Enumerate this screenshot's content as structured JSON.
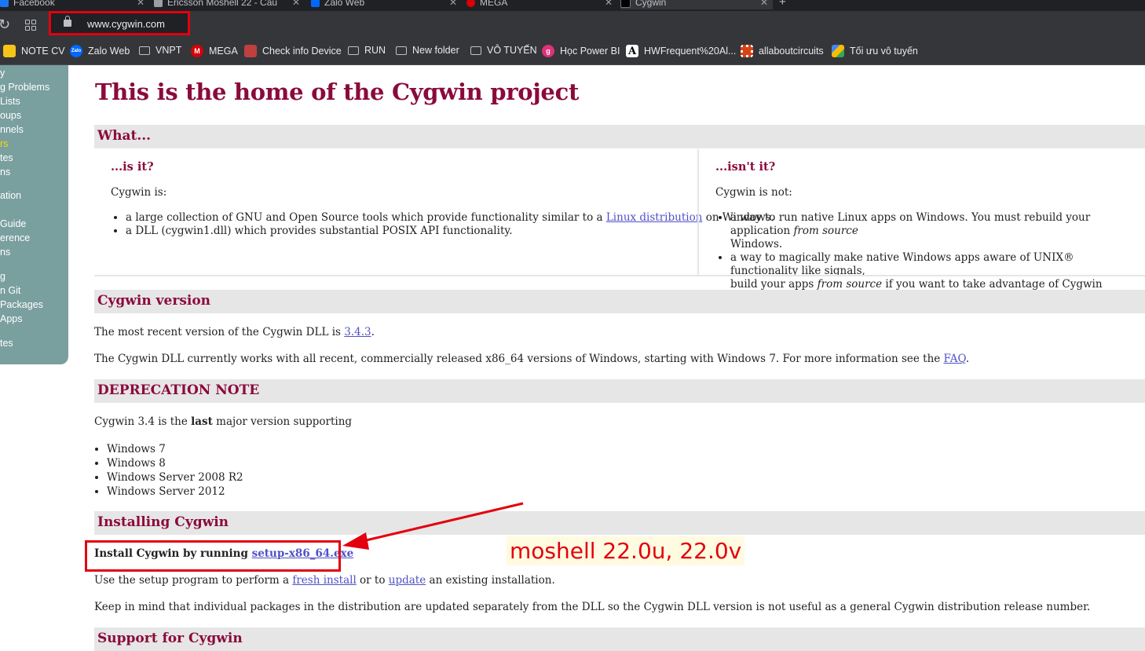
{
  "browser": {
    "tabs": [
      {
        "label": "Facebook",
        "color": "#1877f2"
      },
      {
        "label": "Ericsson Moshell 22 - Câu",
        "color": "#9aa0a6"
      },
      {
        "label": "Zalo Web",
        "color": "#0068ff"
      },
      {
        "label": "MEGA",
        "color": "#d90007"
      },
      {
        "label": "Cygwin",
        "color": "#202124",
        "active": true
      }
    ],
    "url": "www.cygwin.com",
    "bookmarks": [
      {
        "label": "NOTE CV",
        "icon": "note-icon",
        "color": "#f5c518"
      },
      {
        "label": "Zalo Web",
        "icon": "zalo-icon",
        "color": "#0068ff"
      },
      {
        "label": "VNPT",
        "icon": "folder-icon"
      },
      {
        "label": "MEGA",
        "icon": "mega-icon",
        "color": "#d90007"
      },
      {
        "label": "Check info Device",
        "icon": "device-icon",
        "color": "#c04040"
      },
      {
        "label": "RUN",
        "icon": "folder-icon"
      },
      {
        "label": "New folder",
        "icon": "folder-icon"
      },
      {
        "label": "VÔ TUYẾN",
        "icon": "folder-icon"
      },
      {
        "label": "Học Power BI",
        "icon": "powerbi-icon",
        "color": "#e0317a"
      },
      {
        "label": "HWFrequent%20Al...",
        "icon": "a-icon",
        "color": "#ffffff"
      },
      {
        "label": "allaboutcircuits",
        "icon": "circuit-icon",
        "color": "#d84315"
      },
      {
        "label": "Tối ưu vô tuyến",
        "icon": "drive-icon",
        "color": "#34a853"
      }
    ]
  },
  "sidebar": {
    "items": [
      "y",
      "g Problems",
      "Lists",
      "oups",
      "nnels",
      "rs",
      "tes",
      "ns",
      "ation",
      "Guide",
      "erence",
      "ns",
      "g",
      "n Git",
      "Packages",
      "Apps",
      "tes"
    ],
    "current_index": 5
  },
  "page": {
    "title": "This is the home of the Cygwin project",
    "what": {
      "heading": "What...",
      "is_it": {
        "heading": "...is it?",
        "intro": "Cygwin is:",
        "item1_pre": "a large collection of GNU and Open Source tools which provide functionality similar to a ",
        "item1_link": "Linux distribution",
        "item1_post": " on Windows.",
        "item2": "a DLL (cygwin1.dll) which provides substantial POSIX API functionality."
      },
      "isnt_it": {
        "heading": "...isn't it?",
        "intro": "Cygwin is not:",
        "item1_line1_pre": "a way to run native Linux apps on Windows. You must rebuild your application ",
        "item1_line1_em": "from source",
        "item1_line2": "Windows.",
        "item2_line1": "a way to magically make native Windows apps aware of UNIX® functionality like signals,",
        "item2_line2_pre": "build your apps ",
        "item2_line2_em": "from source",
        "item2_line2_post": " if you want to take advantage of Cygwin functionality."
      }
    },
    "version": {
      "heading": "Cygwin version",
      "p1_pre": "The most recent version of the Cygwin DLL is ",
      "p1_link": "3.4.3",
      "p1_post": ".",
      "p2_pre": "The Cygwin DLL currently works with all recent, commercially released x86_64 versions of Windows, starting with Windows 7. For more information see the ",
      "p2_link": "FAQ",
      "p2_post": "."
    },
    "deprecation": {
      "heading": "DEPRECATION NOTE",
      "p_pre": "Cygwin 3.4 is the ",
      "p_bold": "last",
      "p_post": " major version supporting",
      "items": [
        "Windows 7",
        "Windows 8",
        "Windows Server 2008 R2",
        "Windows Server 2012"
      ]
    },
    "installing": {
      "heading": "Installing Cygwin",
      "install_pre": "Install Cygwin by running ",
      "install_link": "setup-x86_64.exe",
      "p1_pre": "Use the setup program to perform a ",
      "p1_link1": "fresh install",
      "p1_mid": " or to ",
      "p1_link2": "update",
      "p1_post": " an existing installation.",
      "p2": "Keep in mind that individual packages in the distribution are updated separately from the DLL so the Cygwin DLL version is not useful as a general Cygwin distribution release number."
    },
    "support": {
      "heading": "Support for Cygwin"
    }
  },
  "annotation": {
    "label": "moshell 22.0u, 22.0v",
    "color": "#e3000f"
  }
}
